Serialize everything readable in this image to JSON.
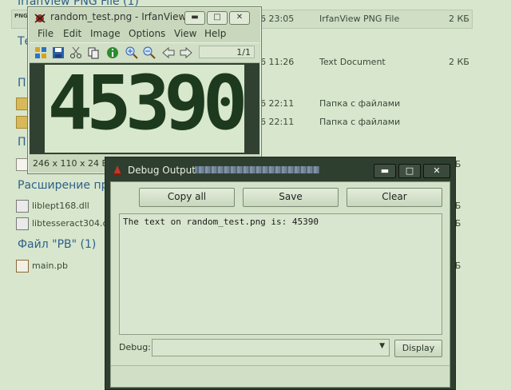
{
  "explorer": {
    "groups": [
      {
        "label": "IrfanView PNG File (1)"
      },
      {
        "label": "Те"
      },
      {
        "label": "П"
      },
      {
        "label": "П"
      },
      {
        "label": "Расширение пр"
      },
      {
        "label": "Файл \"PB\" (1)"
      }
    ],
    "rows": [
      {
        "name": "PNG",
        "date": "6 23:05",
        "type": "IrfanView PNG File",
        "size": "2 КБ"
      },
      {
        "name": "",
        "date": "6 11:26",
        "type": "Text Document",
        "size": "2 КБ"
      },
      {
        "name": "",
        "date": "6 22:11",
        "type": "Папка с файлами",
        "size": ""
      },
      {
        "name": "",
        "date": "6 22:11",
        "type": "Папка с файлами",
        "size": ""
      },
      {
        "name": "",
        "date": "",
        "type": "",
        "size": "КБ"
      },
      {
        "name": "liblept168.dll",
        "date": "",
        "type": "",
        "size": "КБ"
      },
      {
        "name": "libtesseract304.dll",
        "date": "",
        "type": "",
        "size": "КБ"
      },
      {
        "name": "main.pb",
        "date": "",
        "type": "",
        "size": "КБ"
      }
    ]
  },
  "irfanview": {
    "title": "random_test.png - IrfanView",
    "menu": [
      "File",
      "Edit",
      "Image",
      "Options",
      "View",
      "Help"
    ],
    "page": "1/1",
    "image_text": "45390",
    "status": "246 x 110 x 24 BP"
  },
  "debug": {
    "title": "Debug Output",
    "buttons": {
      "copy": "Copy all",
      "save": "Save",
      "clear": "Clear"
    },
    "output": "The text on random_test.png is: 45390",
    "debug_label": "Debug:",
    "debug_value": "",
    "display": "Display"
  }
}
